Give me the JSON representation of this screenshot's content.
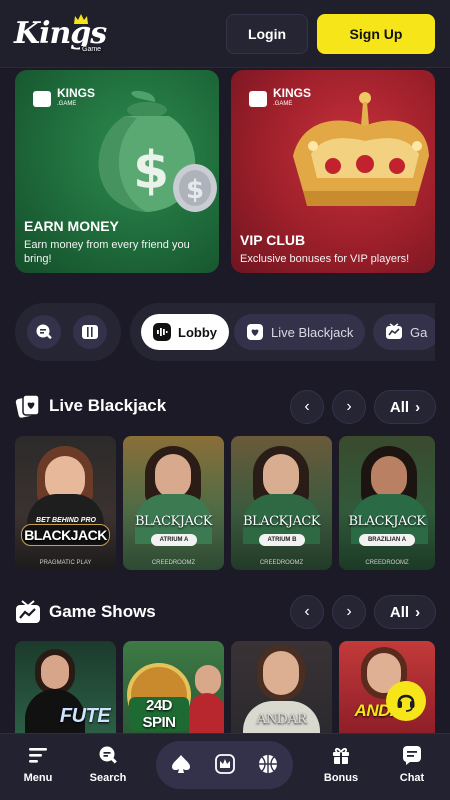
{
  "header": {
    "logo_text": "Kings",
    "logo_sub": "Game",
    "login_label": "Login",
    "signup_label": "Sign Up"
  },
  "promos": [
    {
      "brand": "KINGS",
      "brand_sub": ".GAME",
      "title": "EARN MONEY",
      "description": "Earn money from every friend you bring!"
    },
    {
      "brand": "KINGS",
      "brand_sub": ".GAME",
      "title": "VIP CLUB",
      "description": "Exclusive bonuses for VIP players!"
    }
  ],
  "tabs": {
    "icons": [
      "search-games-icon",
      "library-icon"
    ],
    "categories": [
      {
        "label": "Lobby",
        "icon": "lobby-icon",
        "active": true
      },
      {
        "label": "Live Blackjack",
        "icon": "blackjack-icon",
        "active": false
      },
      {
        "label": "Ga",
        "icon": "game-shows-icon",
        "active": false
      }
    ]
  },
  "sections": [
    {
      "title": "Live Blackjack",
      "all_label": "All",
      "games": [
        {
          "label": "BLACKJACK",
          "badge": "BET BEHIND PRO",
          "provider": "PRAGMATIC PLAY"
        },
        {
          "label": "BLACKJACK",
          "badge": "ATRIUM A",
          "provider": "CREEDROOMZ"
        },
        {
          "label": "BLACKJACK",
          "badge": "ATRIUM B",
          "provider": "CREEDROOMZ"
        },
        {
          "label": "BLACKJACK",
          "badge": "BRAZILIAN A",
          "provider": "CREEDROOMZ"
        }
      ]
    },
    {
      "title": "Game Shows",
      "all_label": "All",
      "games": [
        {
          "label": "FUTE",
          "badge": "",
          "provider": ""
        },
        {
          "label": "24D SPIN",
          "badge": "",
          "provider": ""
        },
        {
          "label": "ANDAR",
          "badge": "",
          "provider": ""
        },
        {
          "label": "ANDAR",
          "badge": "",
          "provider": ""
        }
      ]
    }
  ],
  "bottom_nav": {
    "menu_label": "Menu",
    "search_label": "Search",
    "bonus_label": "Bonus",
    "chat_label": "Chat"
  },
  "colors": {
    "accent": "#f6e619",
    "background": "#1b1a26",
    "panel": "#262534"
  }
}
